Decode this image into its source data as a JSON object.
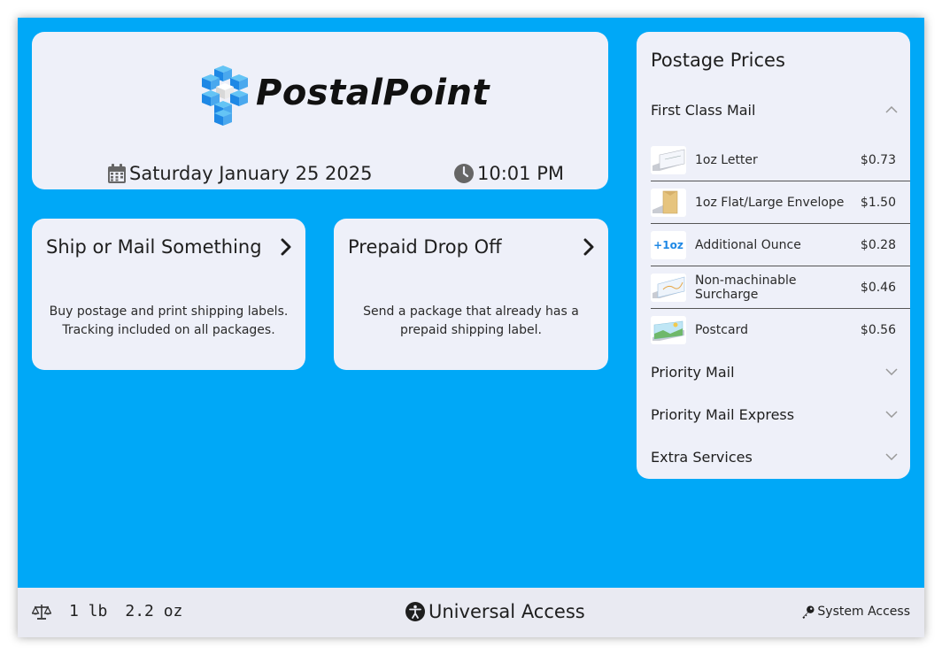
{
  "brand": {
    "name": "PostalPoint"
  },
  "header": {
    "date": "Saturday January 25 2025",
    "time": "10:01 PM"
  },
  "actions": [
    {
      "title": "Ship or Mail Something",
      "description": "Buy postage and print shipping labels. Tracking included on all packages."
    },
    {
      "title": "Prepaid Drop Off",
      "description": "Send a package that already has a prepaid shipping label."
    }
  ],
  "prices": {
    "title": "Postage Prices",
    "sections": [
      {
        "label": "First Class Mail",
        "expanded": true
      },
      {
        "label": "Priority Mail",
        "expanded": false
      },
      {
        "label": "Priority Mail Express",
        "expanded": false
      },
      {
        "label": "Extra Services",
        "expanded": false
      }
    ],
    "items": [
      {
        "label": "1oz Letter",
        "price": "$0.73",
        "icon": "letter-envelope-icon"
      },
      {
        "label": "1oz Flat/Large Envelope",
        "price": "$1.50",
        "icon": "large-envelope-icon"
      },
      {
        "label": "Additional Ounce",
        "price": "$0.28",
        "icon": "plus-ounce-icon",
        "badge": "+1oz"
      },
      {
        "label": "Non-machinable Surcharge",
        "price": "$0.46",
        "icon": "nonmachinable-envelope-icon"
      },
      {
        "label": "Postcard",
        "price": "$0.56",
        "icon": "postcard-icon"
      }
    ]
  },
  "footer": {
    "weight_lb": "1 lb",
    "weight_oz": "2.2 oz",
    "universal_access": "Universal Access",
    "system_access": "System Access"
  },
  "colors": {
    "background": "#00a8f7",
    "card": "#eef0f9",
    "logo_blue": "#1e88e5",
    "bar": "#e9eaf2"
  }
}
